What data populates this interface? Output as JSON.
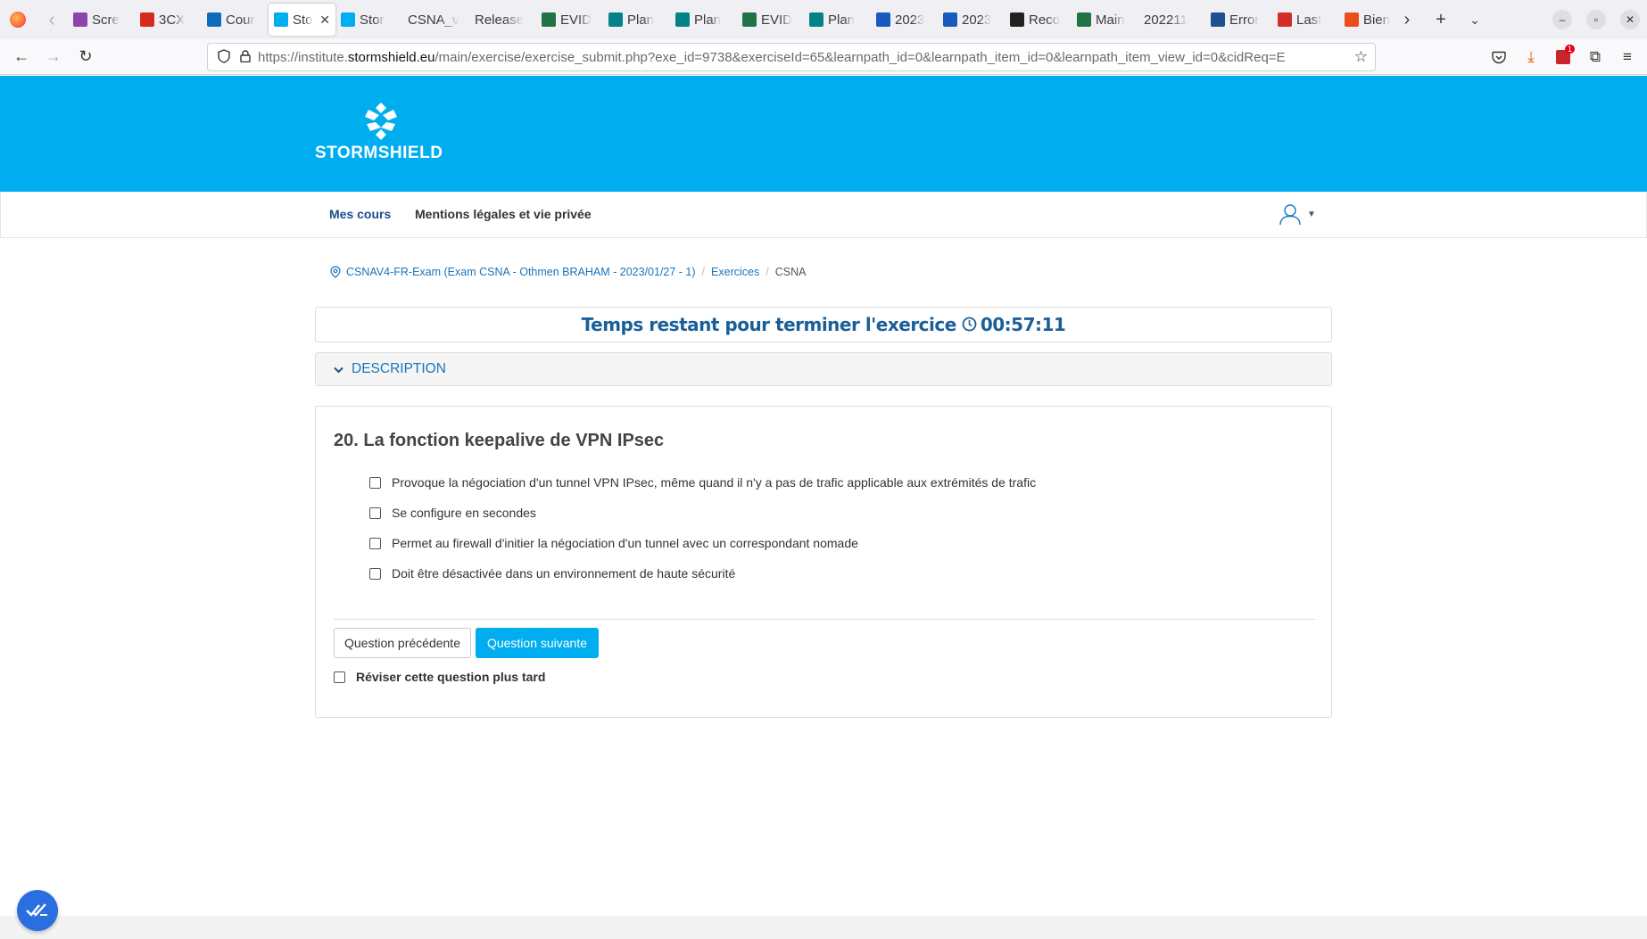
{
  "browser": {
    "tabs": [
      {
        "label": "Scre",
        "icon": "feather-icon",
        "color": "#8e44ad"
      },
      {
        "label": "3CX",
        "icon": "3cx-icon",
        "color": "#d52b1e"
      },
      {
        "label": "Cour",
        "icon": "outlook-icon",
        "color": "#0f6cbd"
      },
      {
        "label": "Sto",
        "icon": "stormshield-icon",
        "color": "#00aeef",
        "active": true
      },
      {
        "label": "Stor",
        "icon": "stormshield-icon",
        "color": "#00aeef"
      },
      {
        "label": "CSNA_v",
        "icon": "",
        "color": ""
      },
      {
        "label": "Release",
        "icon": "",
        "color": ""
      },
      {
        "label": "EVID",
        "icon": "project-icon",
        "color": "#217346"
      },
      {
        "label": "Plan",
        "icon": "sharepoint-icon",
        "color": "#038387"
      },
      {
        "label": "Plan",
        "icon": "sharepoint-icon",
        "color": "#038387"
      },
      {
        "label": "EVID",
        "icon": "project-icon",
        "color": "#217346"
      },
      {
        "label": "Plan",
        "icon": "sharepoint-icon",
        "color": "#038387"
      },
      {
        "label": "2023",
        "icon": "word-icon",
        "color": "#185abd"
      },
      {
        "label": "2023",
        "icon": "word-icon",
        "color": "#185abd"
      },
      {
        "label": "Reco",
        "icon": "cx-icon",
        "color": "#222222"
      },
      {
        "label": "Main",
        "icon": "project-icon",
        "color": "#217346"
      },
      {
        "label": "202211",
        "icon": "",
        "color": ""
      },
      {
        "label": "Error",
        "icon": "pf-icon",
        "color": "#1d4f91"
      },
      {
        "label": "Last",
        "icon": "lastpass-icon",
        "color": "#d32d27"
      },
      {
        "label": "Bien",
        "icon": "gauge-icon",
        "color": "#e94e1b"
      }
    ],
    "url_prefix": "https://institute.",
    "url_domain": "stormshield.eu",
    "url_path": "/main/exercise/exercise_submit.php?exe_id=9738&exerciseId=65&learnpath_id=0&learnpath_item_id=0&learnpath_item_view_id=0&cidReq=E",
    "downloads_badge": "1"
  },
  "site": {
    "logo_text": "STORMSHIELD",
    "menu": {
      "courses": "Mes cours",
      "legal": "Mentions légales et vie privée"
    }
  },
  "breadcrumb": {
    "course": "CSNAV4-FR-Exam (Exam CSNA - Othmen BRAHAM - 2023/01/27 - 1)",
    "section": "Exercices",
    "current": "CSNA"
  },
  "timer": {
    "label": "Temps restant pour terminer l'exercice",
    "value": "00:57:11"
  },
  "description": {
    "label": "DESCRIPTION"
  },
  "question": {
    "title": "20. La fonction keepalive de VPN IPsec",
    "answers": [
      "Provoque la négociation d'un tunnel VPN IPsec, même quand il n'y a pas de trafic applicable aux extrémités de trafic",
      "Se configure en secondes",
      "Permet au firewall d'initier la négociation d'un tunnel avec un correspondant nomade",
      "Doit être désactivée dans un environnement de haute sécurité"
    ],
    "prev_label": "Question précédente",
    "next_label": "Question suivante",
    "review_label": "Réviser cette question plus tard"
  },
  "colors": {
    "brand": "#00aeef",
    "link": "#1a75bb",
    "timer": "#1a5f99"
  }
}
